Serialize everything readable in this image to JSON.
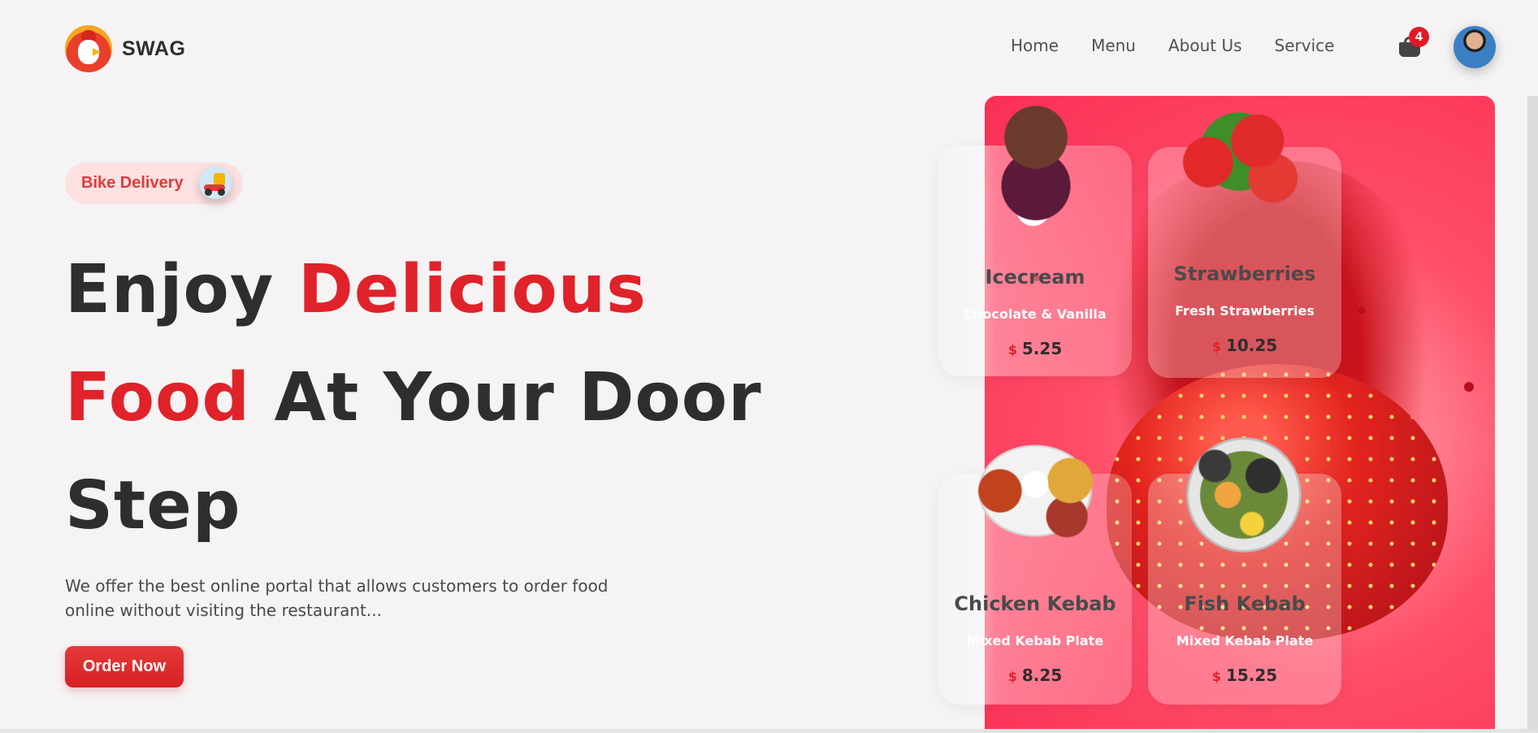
{
  "brand": {
    "name": "SWAG",
    "logo_icon": "chicken-chef-logo"
  },
  "nav": {
    "items": [
      {
        "label": "Home"
      },
      {
        "label": "Menu"
      },
      {
        "label": "About Us"
      },
      {
        "label": "Service"
      }
    ]
  },
  "cart": {
    "count": "4",
    "icon": "basket-icon"
  },
  "user": {
    "avatar": "user-avatar"
  },
  "hero": {
    "badge_label": "Bike Delivery",
    "badge_icon": "delivery-bike-icon",
    "headline": {
      "part1": "Enjoy ",
      "part2": "Delicious",
      "part3": "Food",
      "part4": " At Your Door",
      "part5": "Step"
    },
    "description": "We offer the best online portal that allows customers to order food online without visiting the restaurant...",
    "cta_label": "Order Now"
  },
  "cards": [
    {
      "title": "Icecream",
      "subtitle": "Chocolate & Vanilla",
      "currency": "$",
      "price": "5.25"
    },
    {
      "title": "Strawberries",
      "subtitle": "Fresh Strawberries",
      "currency": "$",
      "price": "10.25"
    },
    {
      "title": "Chicken Kebab",
      "subtitle": "Mixed Kebab Plate",
      "currency": "$",
      "price": "8.25"
    },
    {
      "title": "Fish Kebab",
      "subtitle": "Mixed Kebab Plate",
      "currency": "$",
      "price": "15.25"
    }
  ],
  "colors": {
    "accent": "#e0222a",
    "panel": "#fb2e55",
    "background": "#f5f3f3"
  }
}
